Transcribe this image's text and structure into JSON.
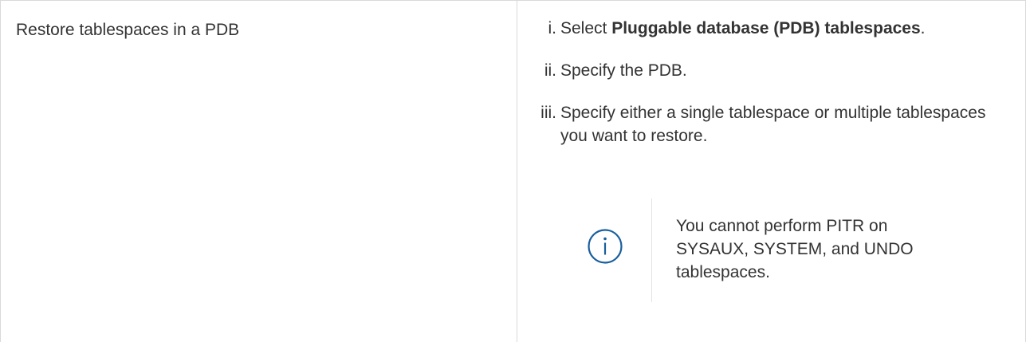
{
  "left_cell": {
    "text": "Restore tablespaces in a PDB"
  },
  "steps": [
    {
      "num": "i.",
      "before": "Select ",
      "bold": "Pluggable database (PDB) tablespaces",
      "after": "."
    },
    {
      "num": "ii.",
      "text": "Specify the PDB."
    },
    {
      "num": "iii.",
      "text": "Specify either a single tablespace or multiple tablespaces you want to restore."
    }
  ],
  "note": {
    "icon": "info-icon",
    "text": "You cannot perform PITR on SYSAUX, SYSTEM, and UNDO tablespaces."
  },
  "colors": {
    "text": "#333333",
    "border": "#d9d9d9",
    "info_icon": "#1a5f9e"
  }
}
